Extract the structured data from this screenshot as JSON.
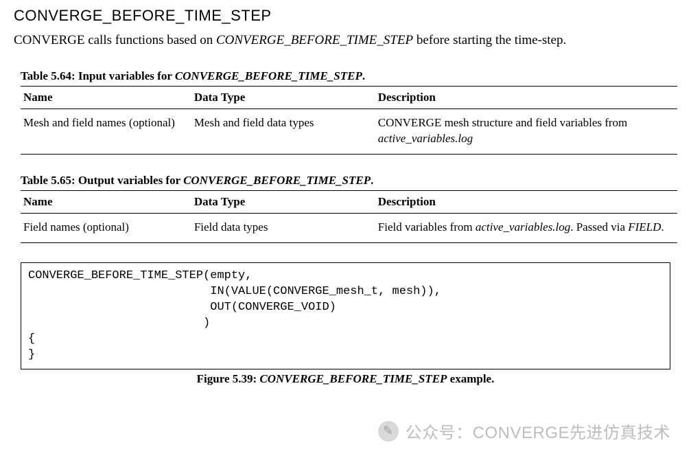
{
  "section": {
    "title": "CONVERGE_BEFORE_TIME_STEP",
    "body_pre": "CONVERGE calls functions based on ",
    "body_em": "CONVERGE_BEFORE_TIME_STEP",
    "body_post": " before starting the time-step."
  },
  "table1": {
    "caption_pre": "Table  5.64: Input variables for ",
    "caption_em": "CONVERGE_BEFORE_TIME_STEP",
    "caption_post": ".",
    "headers": {
      "name": "Name",
      "type": "Data Type",
      "desc": "Description"
    },
    "row": {
      "name": "Mesh and field names (optional)",
      "type": "Mesh and field data types",
      "desc_pre": "CONVERGE mesh structure and field variables from ",
      "desc_em": "active_variables.log"
    }
  },
  "table2": {
    "caption_pre": "Table  5.65: Output variables for ",
    "caption_em": "CONVERGE_BEFORE_TIME_STEP",
    "caption_post": ".",
    "headers": {
      "name": "Name",
      "type": "Data Type",
      "desc": "Description"
    },
    "row": {
      "name": "Field names (optional)",
      "type": "Field data types",
      "desc_pre": "Field variables from ",
      "desc_em": "active_variables.log",
      "desc_mid": ". Passed via ",
      "desc_em2": "FIELD",
      "desc_post": "."
    }
  },
  "code": "CONVERGE_BEFORE_TIME_STEP(empty,\n                          IN(VALUE(CONVERGE_mesh_t, mesh)),\n                          OUT(CONVERGE_VOID)\n                         )\n{\n}",
  "figure": {
    "caption_pre": "Figure 5.39: ",
    "caption_em": "CONVERGE_BEFORE_TIME_STEP",
    "caption_post": " example."
  },
  "watermark": {
    "label_pre": "公众号：",
    "label_post": "CONVERGE先进仿真技术"
  }
}
